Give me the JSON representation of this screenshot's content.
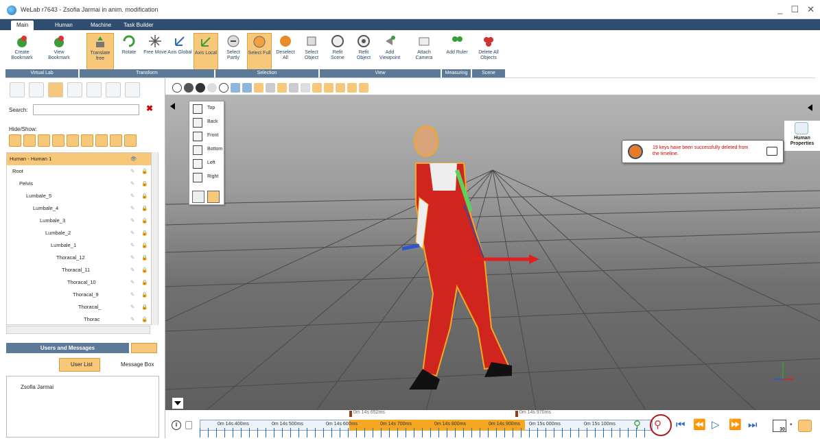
{
  "window": {
    "title": "WeLab r7643 - Zsofia Jarmai in anim. modification"
  },
  "tabs": [
    "Main",
    "Human",
    "Machine",
    "Task Builder"
  ],
  "ribbon": {
    "buttons": [
      {
        "label": "Create Bookmark"
      },
      {
        "label": "View Bookmark"
      },
      {
        "label": "Translate free"
      },
      {
        "label": "Rotate"
      },
      {
        "label": "Free Move"
      },
      {
        "label": "Axis Global"
      },
      {
        "label": "Axis Local"
      },
      {
        "label": "Select Partly"
      },
      {
        "label": "Select Full"
      },
      {
        "label": "Deselect All"
      },
      {
        "label": "Select Object"
      },
      {
        "label": "Refit Scene"
      },
      {
        "label": "Refit Object"
      },
      {
        "label": "Add Viewpoint"
      },
      {
        "label": "Attach Camera"
      },
      {
        "label": "Add Ruler"
      },
      {
        "label": "Delete All Objects"
      }
    ],
    "groups": [
      "Virtual Lab",
      "Transform",
      "Selection",
      "View",
      "Measuring",
      "Scene"
    ]
  },
  "left_panel": {
    "search_label": "Search:",
    "search_value": "",
    "hide_show_label": "Hide/Show:",
    "tree": [
      {
        "label": "Human - Human 1",
        "depth": 0
      },
      {
        "label": "Root",
        "depth": 1
      },
      {
        "label": "Pelvis",
        "depth": 2
      },
      {
        "label": "Lumbale_5",
        "depth": 3
      },
      {
        "label": "Lumbale_4",
        "depth": 4
      },
      {
        "label": "Lumbale_3",
        "depth": 5
      },
      {
        "label": "Lumbale_2",
        "depth": 6
      },
      {
        "label": "Lumbale_1",
        "depth": 7
      },
      {
        "label": "Thoracal_12",
        "depth": 8
      },
      {
        "label": "Thoracal_11",
        "depth": 9
      },
      {
        "label": "Thoracal_10",
        "depth": 10
      },
      {
        "label": "Thoracal_9",
        "depth": 11
      },
      {
        "label": "Thoracal_",
        "depth": 12
      },
      {
        "label": "Thorac",
        "depth": 13
      }
    ],
    "users_messages_title": "Users and Messages",
    "user_list_label": "User List",
    "message_box_label": "Message Box",
    "user": "Zsofia Jarmai"
  },
  "viewport": {
    "view_menu": [
      "Top",
      "Back",
      "Front",
      "Bottom",
      "Left",
      "Right"
    ],
    "human_properties_label": "Human Properties",
    "notification": "19 keys have been successfully deleted from the timeline."
  },
  "timeline": {
    "markers": [
      "0m 14s 652ms",
      "0m 14s 970ms"
    ],
    "tick_labels": [
      "0m 14s 400ms",
      "0m 14s 500ms",
      "0m 14s 600ms",
      "0m 14s 700ms",
      "0m 14s 800ms",
      "0m 14s 900ms",
      "0m 15s 000ms",
      "0m 15s 100ms"
    ],
    "fps": "30"
  }
}
